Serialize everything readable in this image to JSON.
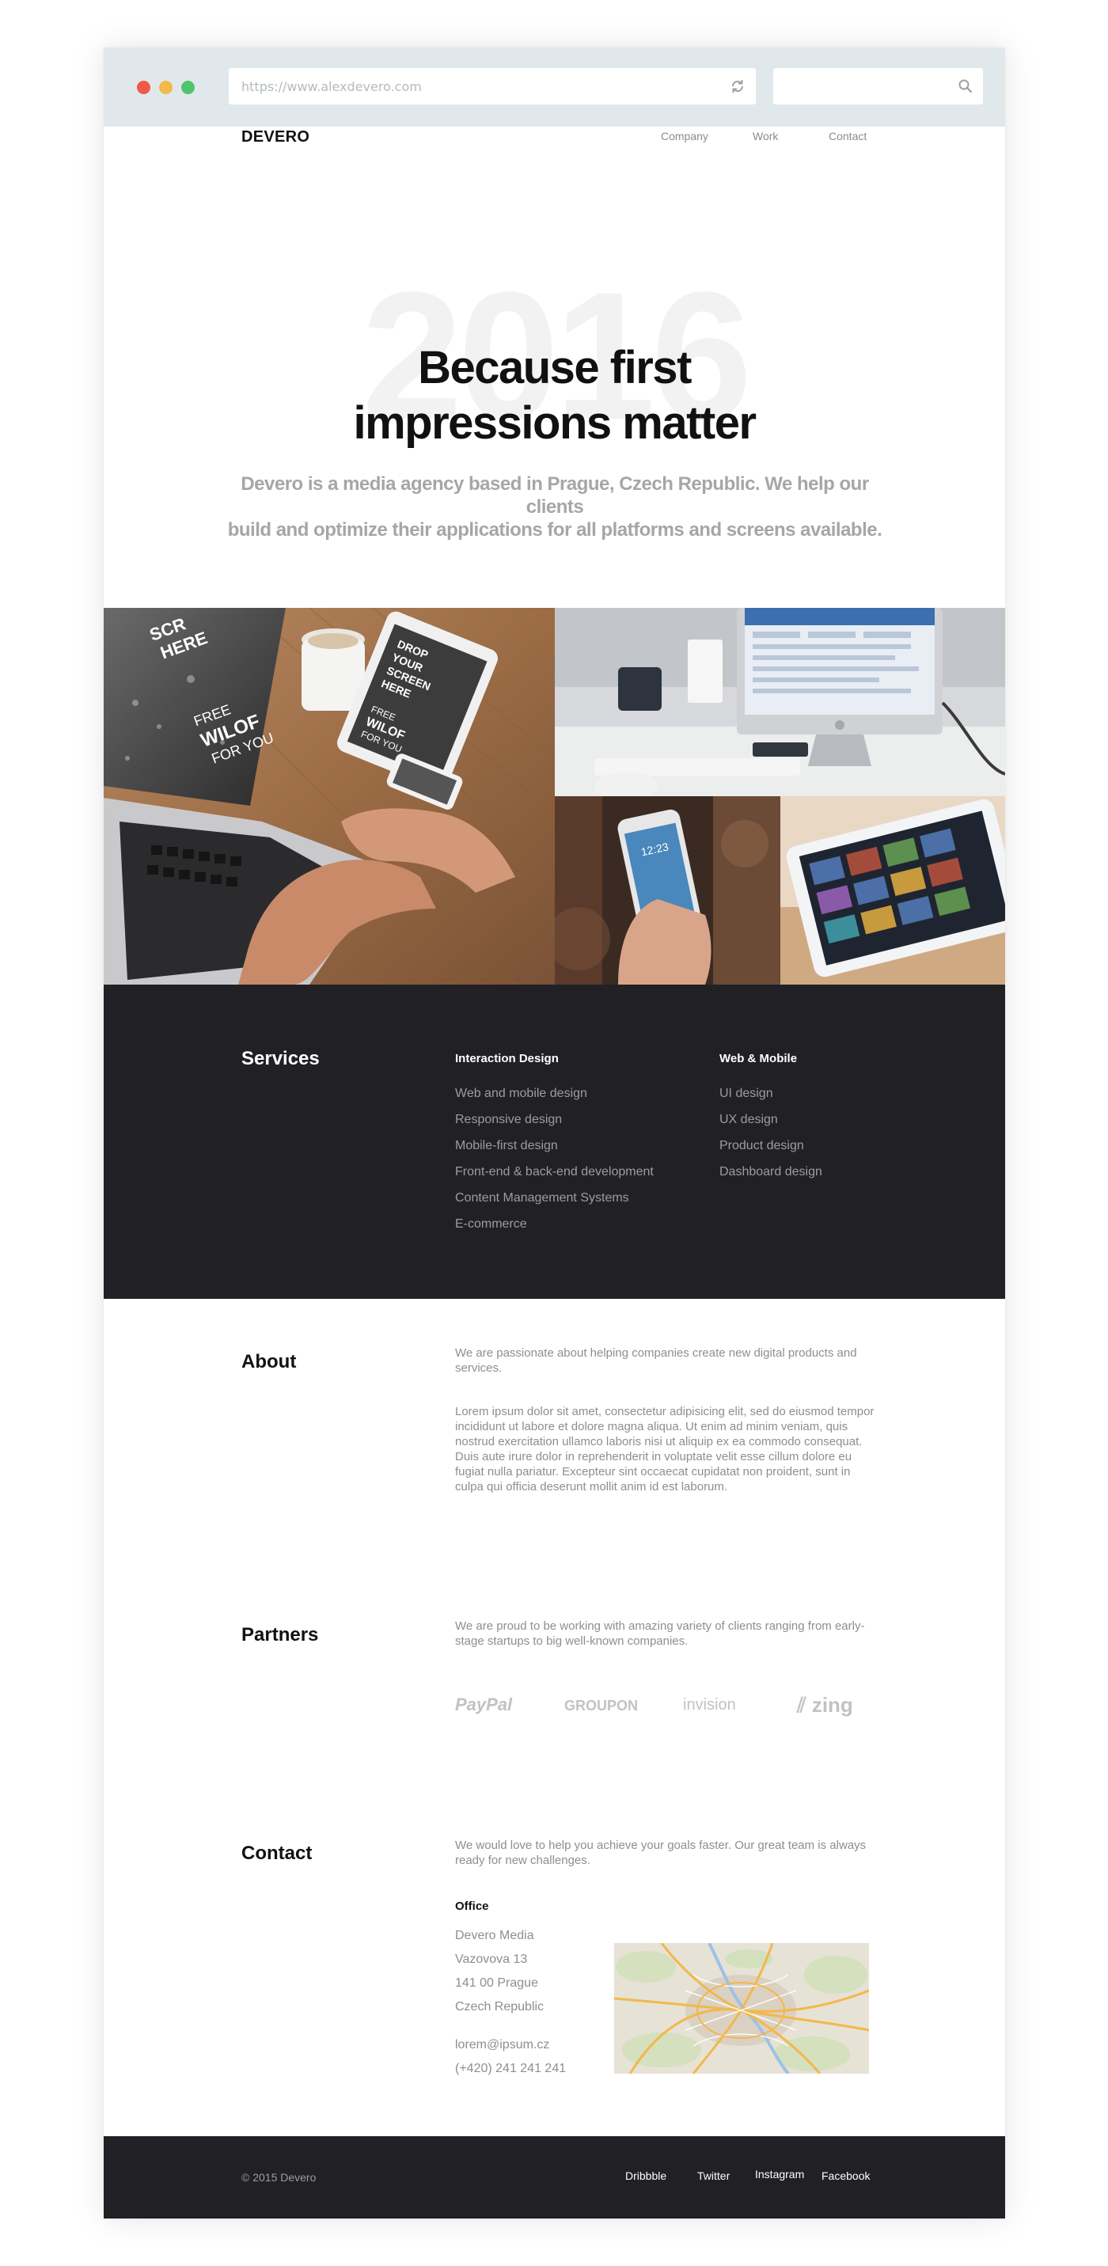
{
  "browser": {
    "url": "https://www.alexdevero.com",
    "search_value": ""
  },
  "nav": {
    "logo": "DEVERO",
    "links": [
      "Company",
      "Work",
      "Contact"
    ]
  },
  "hero": {
    "year": "2016",
    "title_line1": "Because first",
    "title_line2": "impressions matter",
    "subtitle_line1": "Devero is a media agency based in Prague, Czech Republic. We help our clients",
    "subtitle_line2": "build and optimize their applications for all platforms and screens available."
  },
  "gallery": {
    "laptop_screen_text": [
      "SCR",
      "HERE",
      "FREE",
      "WILOF",
      "FOR YOU"
    ],
    "tablet_screen_text": [
      "DROP",
      "YOUR",
      "SCREEN",
      "HERE",
      "FREE",
      "WILOF",
      "FOR YOU"
    ],
    "phone_time": "12:23"
  },
  "services": {
    "title": "Services",
    "col1": {
      "heading": "Interaction Design",
      "items": [
        "Web and mobile design",
        "Responsive design",
        "Mobile-first design",
        "Front-end & back-end development",
        "Content Management Systems",
        "E-commerce"
      ]
    },
    "col2": {
      "heading": "Web & Mobile",
      "items": [
        "UI design",
        "UX design",
        "Product design",
        "Dashboard design"
      ]
    }
  },
  "about": {
    "title": "About",
    "intro": "We are passionate about helping companies create new digital products and services.",
    "body": "Lorem ipsum dolor sit amet, consectetur adipisicing elit, sed do eiusmod tempor incididunt ut labore et dolore magna aliqua. Ut enim ad minim veniam, quis nostrud exercitation ullamco laboris nisi ut aliquip ex ea commodo consequat. Duis aute irure dolor in reprehenderit in voluptate velit esse cillum dolore eu fugiat nulla pariatur. Excepteur sint occaecat cupidatat non proident, sunt in culpa qui officia deserunt mollit anim id est laborum."
  },
  "partners": {
    "title": "Partners",
    "intro": "We are proud to be working with amazing variety of clients ranging from early-stage  startups to big well-known companies.",
    "logos": [
      "PayPal",
      "GROUPON",
      "invision",
      "zing"
    ]
  },
  "contact": {
    "title": "Contact",
    "intro": "We would love to help you achieve your goals faster. Our great team  is always ready for new challenges.",
    "office_heading": "Office",
    "address": [
      "Devero Media",
      "Vazovova 13",
      "141 00 Prague",
      "Czech Republic"
    ],
    "email": "lorem@ipsum.cz",
    "phone": "(+420) 241 241 241"
  },
  "footer": {
    "copyright": "© 2015 Devero",
    "links": [
      "Dribbble",
      "Twitter",
      "Instagram",
      "Facebook"
    ]
  }
}
